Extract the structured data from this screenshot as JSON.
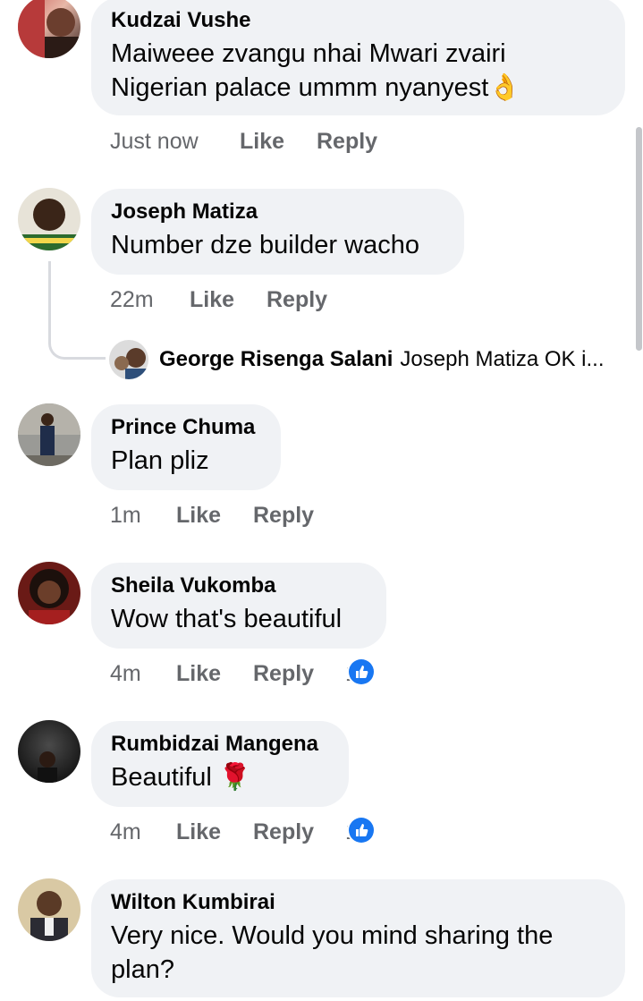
{
  "labels": {
    "like": "Like",
    "reply": "Reply"
  },
  "comments": [
    {
      "author": "Kudzai Vushe",
      "text": "Maiweee zvangu nhai Mwari zvairi Nigerian palace ummm nyanyest",
      "emoji": "👌",
      "time": "Just now"
    },
    {
      "author": "Joseph Matiza",
      "text": "Number dze builder wacho",
      "time": "22m"
    },
    {
      "author": "Prince Chuma",
      "text": "Plan pliz",
      "time": "1m"
    },
    {
      "author": "Sheila Vukomba",
      "text": "Wow that's beautiful",
      "time": "4m",
      "reactions": "1"
    },
    {
      "author": "Rumbidzai Mangena",
      "text": "Beautiful",
      "emoji": "🌹",
      "time": "4m",
      "reactions": "1"
    },
    {
      "author": "Wilton Kumbirai",
      "text": "Very nice. Would you mind sharing the plan?"
    }
  ],
  "reply_preview": {
    "author": "George Risenga Salani",
    "snippet": "Joseph Matiza OK i..."
  },
  "colors": {
    "bubble": "#f0f2f5",
    "meta": "#65676b",
    "like_badge": "#1877f2"
  }
}
